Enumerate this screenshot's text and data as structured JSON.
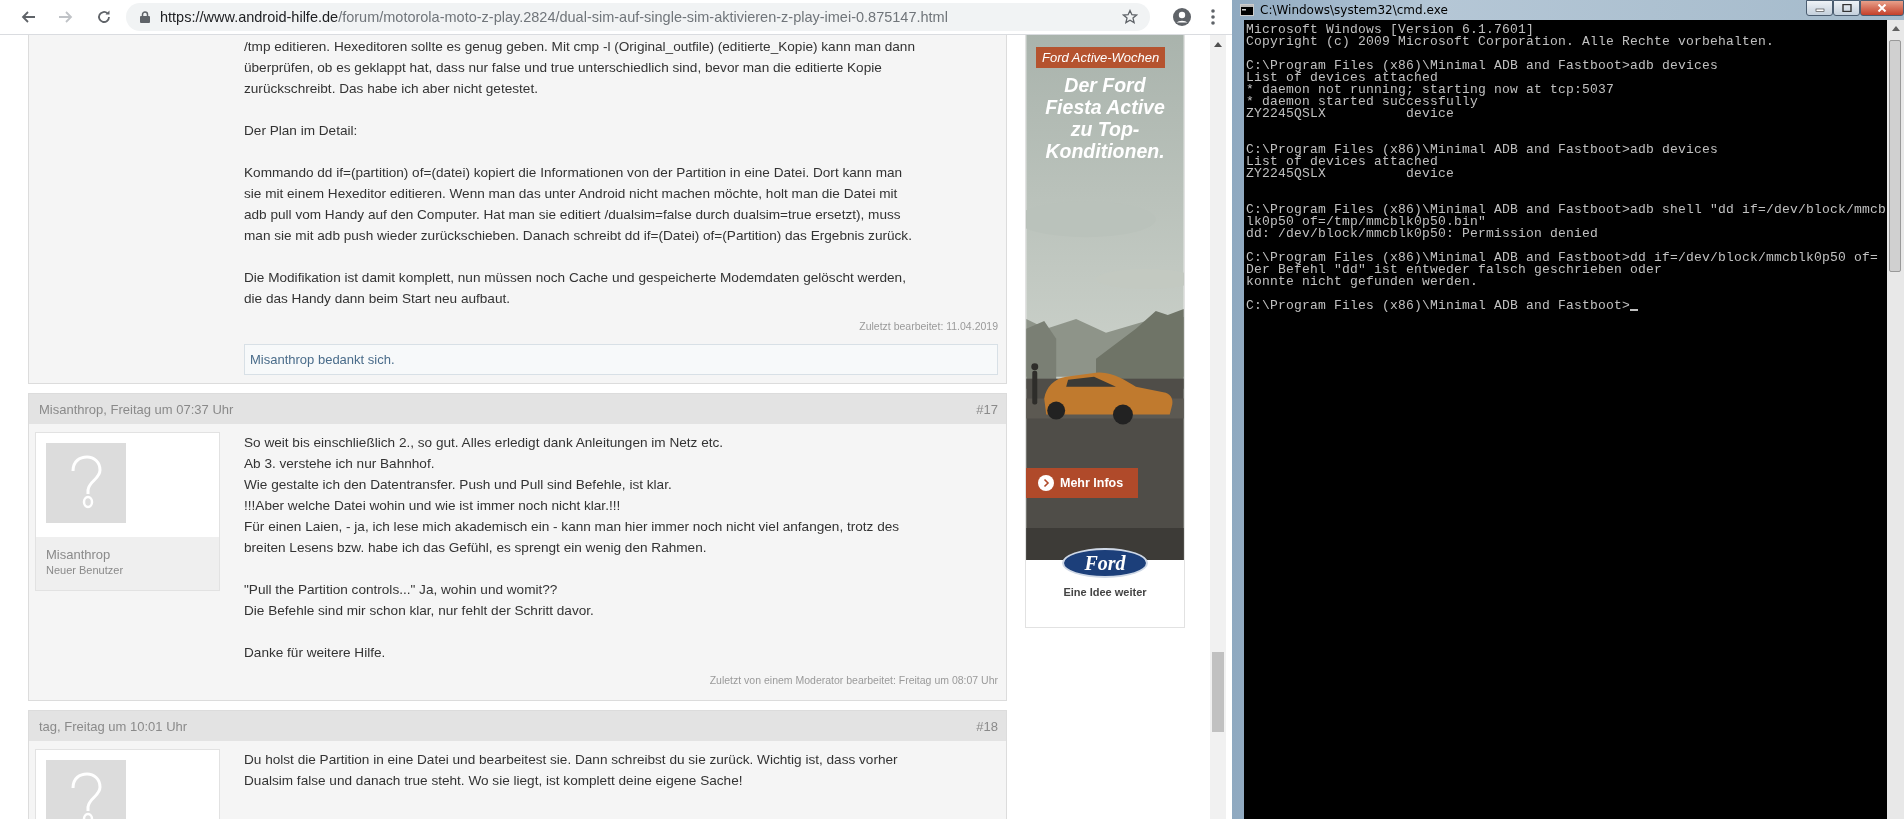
{
  "browser": {
    "nav": [
      {
        "kind": "back",
        "disabled": false
      },
      {
        "kind": "forward",
        "disabled": true
      },
      {
        "kind": "reload",
        "disabled": false
      }
    ],
    "url_host": "https://www.android-hilfe.de",
    "url_path": "/forum/motorola-moto-z-play.2824/dual-sim-auf-single-sim-aktivieren-z-play-imei-0.875147.html",
    "posts": [
      {
        "has_card": false,
        "paragraphs": [
          [
            "/tmp editieren. Hexeditoren sollte es genug geben. Mit cmp -l (Original_outfile) (editierte_Kopie) kann man dann",
            "überprüfen, ob es geklappt hat, dass nur false und true unterschiedlich sind, bevor man die editierte Kopie",
            "zurückschreibt. Das habe ich aber nicht getestet."
          ],
          [
            "Der Plan im Detail:"
          ],
          [
            "Kommando dd if=(partition) of=(datei) kopiert die Informationen von der Partition in eine Datei. Dort kann man",
            "sie mit einem Hexeditor editieren. Wenn man das unter Android nicht machen möchte, holt man die Datei mit",
            "adb pull vom Handy auf den Computer. Hat man sie editiert /dualsim=false durch dualsim=true ersetzt), muss",
            "man sie mit adb push wieder zurückschieben. Danach schreibt dd if=(Datei) of=(Partition) das Ergebnis zurück."
          ],
          [
            "Die Modifikation ist damit komplett, nun müssen noch Cache und gespeicherte Modemdaten gelöscht werden,",
            "die das Handy dann beim Start neu aufbaut."
          ]
        ],
        "edit_note": "Zuletzt bearbeitet: 11.04.2019",
        "thanks": "Misanthrop bedankt sich."
      },
      {
        "author_line": "Misanthrop, Freitag um 07:37 Uhr",
        "number": "#17",
        "has_card": true,
        "author_name": "Misanthrop",
        "author_title": "Neuer Benutzer",
        "paragraphs": [
          [
            "So weit bis einschließlich 2., so gut. Alles erledigt dank Anleitungen im Netz etc.",
            "Ab 3. verstehe ich nur Bahnhof.",
            "Wie gestalte ich den Datentransfer. Push und Pull sind Befehle, ist klar.",
            "!!!Aber welche Datei wohin und wie ist immer noch nicht klar.!!!",
            "Für einen Laien, - ja, ich lese mich akademisch ein - kann man hier immer noch nicht viel anfangen, trotz des",
            "breiten Lesens bzw. habe ich das Gefühl, es sprengt ein wenig den Rahmen."
          ],
          [
            "\"Pull the Partition controls...\" Ja, wohin und womit??",
            "Die Befehle sind mir schon klar, nur fehlt der Schritt davor."
          ],
          [
            "Danke für weitere Hilfe."
          ]
        ],
        "edit_note": "Zuletzt von einem Moderator bearbeitet: Freitag um 08:07 Uhr"
      },
      {
        "author_line": "tag, Freitag um 10:01 Uhr",
        "number": "#18",
        "has_card": true,
        "paragraphs": [
          [
            "Du holst die Partition in eine Datei und bearbeitest sie. Dann schreibst du sie zurück. Wichtig ist, dass vorher",
            "Dualsim false und danach true steht. Wo sie liegt, ist komplett deine eigene Sache!"
          ]
        ]
      }
    ],
    "ad": {
      "tag": "Ford Active-Wochen",
      "headline": [
        "Der Ford",
        "Fiesta Active",
        "zu Top-",
        "Konditionen."
      ],
      "button": "Mehr Infos",
      "logo": "Ford",
      "slogan": "Eine Idee weiter"
    }
  },
  "console": {
    "title": "C:\\Windows\\system32\\cmd.exe",
    "blocks": [
      {
        "extra_gap": false,
        "lines": [
          "Microsoft Windows [Version 6.1.7601]",
          "Copyright (c) 2009 Microsoft Corporation. Alle Rechte vorbehalten."
        ]
      },
      {
        "extra_gap": true,
        "lines": [
          "C:\\Program Files (x86)\\Minimal ADB and Fastboot>adb devices",
          "List of devices attached",
          "* daemon not running; starting now at tcp:5037",
          "* daemon started successfully",
          "ZY2245QSLX          device"
        ]
      },
      {
        "extra_gap": true,
        "lines": [
          "C:\\Program Files (x86)\\Minimal ADB and Fastboot>adb devices",
          "List of devices attached",
          "ZY2245QSLX          device"
        ]
      },
      {
        "extra_gap": false,
        "lines": [
          "C:\\Program Files (x86)\\Minimal ADB and Fastboot>adb shell \"dd if=/dev/block/mmcb",
          "lk0p50 of=/tmp/mmcblk0p50.bin\"",
          "dd: /dev/block/mmcblk0p50: Permission denied"
        ]
      },
      {
        "extra_gap": false,
        "lines": [
          "C:\\Program Files (x86)\\Minimal ADB and Fastboot>dd if=/dev/block/mmcblk0p50 of=",
          "Der Befehl \"dd\" ist entweder falsch geschrieben oder",
          "konnte nicht gefunden werden."
        ]
      },
      {
        "extra_gap": false,
        "cursor": true,
        "lines": [
          "C:\\Program Files (x86)\\Minimal ADB and Fastboot>"
        ]
      }
    ]
  }
}
